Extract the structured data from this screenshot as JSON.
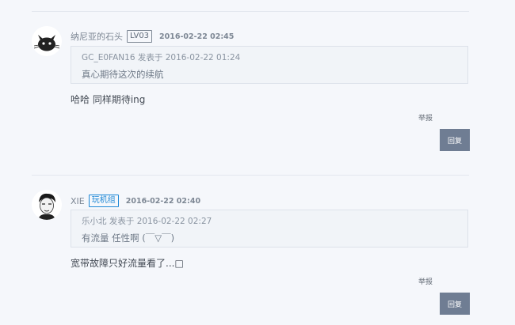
{
  "comments": [
    {
      "username": "纳尼亚的石头",
      "badge": "LV03",
      "time": "2016-02-22 02:45",
      "quote_author": "GC_E0FAN16",
      "quote_verb": "发表于",
      "quote_time": "2016-02-22 01:24",
      "quote_text": "真心期待这次的续航",
      "text": "哈哈 同样期待ing",
      "report_label": "举报",
      "reply_label": "回复",
      "avatar_icon": "cat-avatar-icon"
    },
    {
      "username": "XIE",
      "badge": "玩机组",
      "time": "2016-02-22 02:40",
      "quote_author": "乐小北",
      "quote_verb": "发表于",
      "quote_time": "2016-02-22 02:27",
      "quote_text": "有流量 任性啊 (￣▽￣)",
      "text": "宽带故障只好流量看了...□",
      "report_label": "举报",
      "reply_label": "回复",
      "avatar_icon": "man-avatar-icon"
    }
  ],
  "colors": {
    "background": "#f5f7fb",
    "group_badge": "#1e88d6",
    "reply_button": "#6f7d93"
  }
}
